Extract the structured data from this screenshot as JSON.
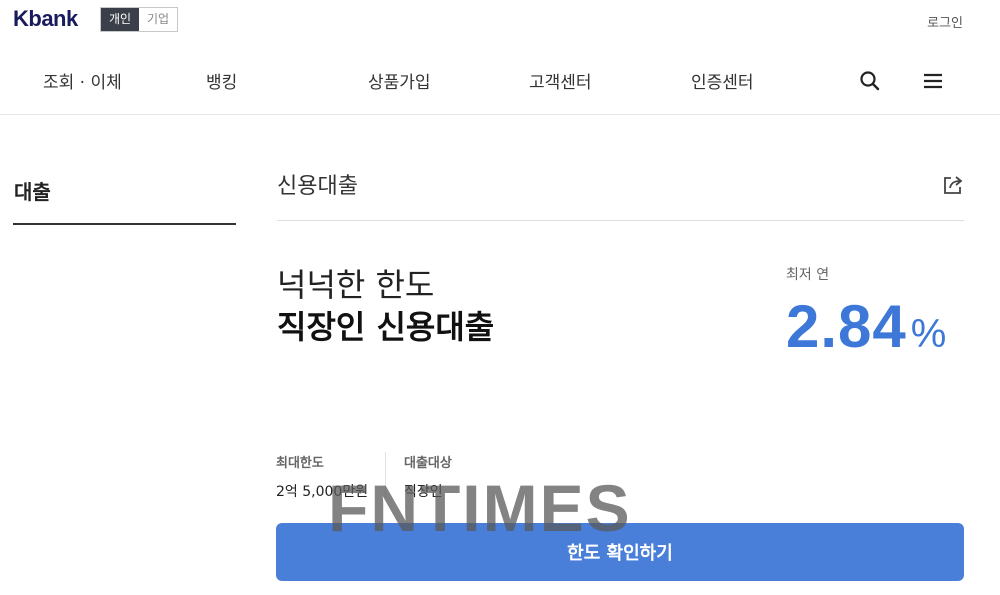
{
  "header": {
    "logo": "Kbank",
    "segments": {
      "personal": "개인",
      "business": "기업"
    },
    "login_label": "로그인"
  },
  "nav": {
    "items": [
      "조회 · 이체",
      "뱅킹",
      "상품가입",
      "고객센터",
      "인증센터"
    ],
    "icons": [
      "search-icon",
      "menu-icon"
    ]
  },
  "sidebar": {
    "title": "대출"
  },
  "main": {
    "title": "신용대출",
    "subtitle": "넉넉한 한도",
    "headline": "직장인 신용대출",
    "rate_label": "최저 연",
    "rate_value": "2.84",
    "rate_unit": "%",
    "info": [
      {
        "label": "최대한도",
        "value": "2억 5,000만원"
      },
      {
        "label": "대출대상",
        "value": "직장인"
      }
    ],
    "cta_label": "한도 확인하기"
  },
  "watermark": "FNTIMES",
  "colors": {
    "accent": "#4a7fd9",
    "rate": "#3d78d8",
    "brand": "#1a1a5e"
  }
}
